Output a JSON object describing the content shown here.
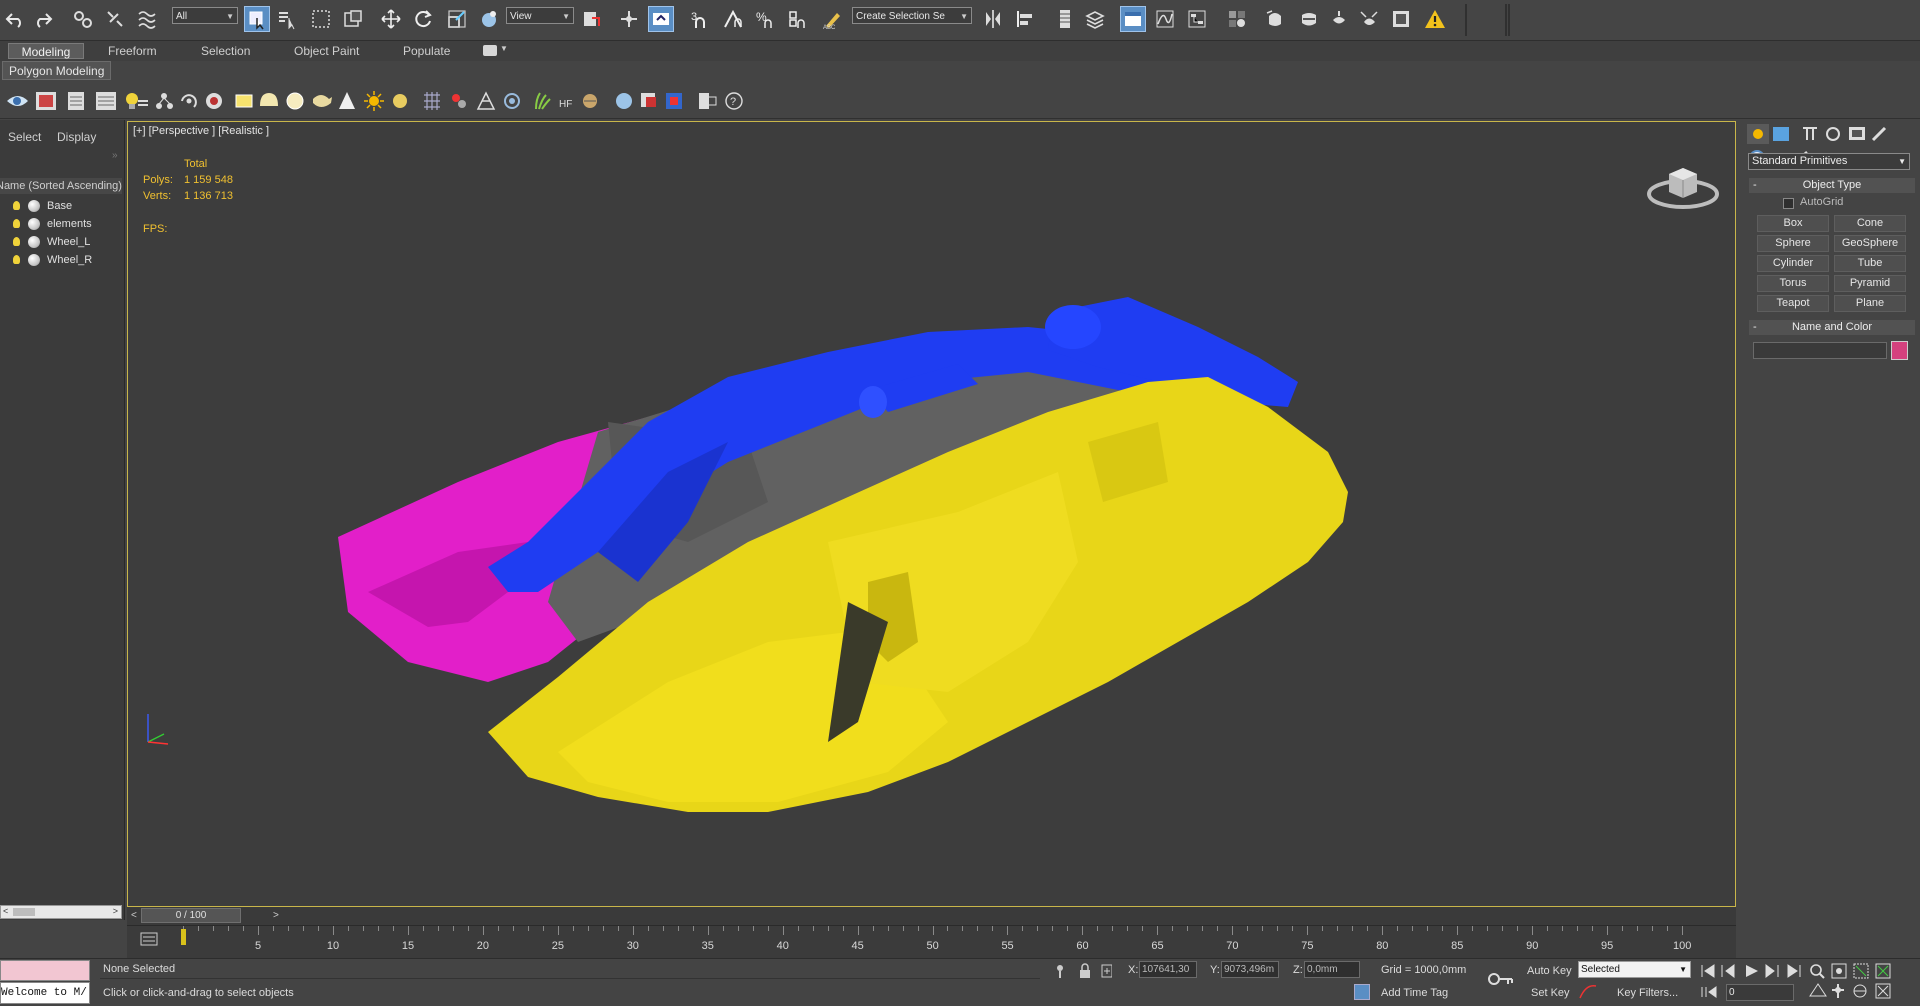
{
  "toolbar": {
    "selection_filter": "All",
    "ref_coord": "View",
    "named_selection_set": "Create Selection Se"
  },
  "ribbon": {
    "tabs": [
      "Modeling",
      "Freeform",
      "Selection",
      "Object Paint",
      "Populate"
    ],
    "active_tab": "Modeling",
    "panel_label": "Polygon Modeling"
  },
  "scene_explorer": {
    "tabs": [
      "Select",
      "Display"
    ],
    "header": "Name (Sorted Ascending)",
    "items": [
      "Base",
      "elements",
      "Wheel_L",
      "Wheel_R"
    ]
  },
  "viewport": {
    "label": "[+] [Perspective ] [Realistic ]",
    "stats": {
      "total_label": "Total",
      "polys_label": "Polys:",
      "polys_value": "1 159 548",
      "verts_label": "Verts:",
      "verts_value": "1 136 713",
      "fps_label": "FPS:"
    },
    "object_colors": {
      "tracks_left": "#e21fc9",
      "frame": "#1f3df2",
      "tracks_right": "#e8d618",
      "hull": "#616161"
    }
  },
  "command_panel": {
    "category": "Standard Primitives",
    "object_type_title": "Object Type",
    "autogrid": "AutoGrid",
    "buttons": [
      "Box",
      "Cone",
      "Sphere",
      "GeoSphere",
      "Cylinder",
      "Tube",
      "Torus",
      "Pyramid",
      "Teapot",
      "Plane"
    ],
    "name_color_title": "Name and Color",
    "swatch_color": "#d4417e"
  },
  "timeline": {
    "slider_label": "0 / 100",
    "ticks": [
      "5",
      "10",
      "15",
      "20",
      "25",
      "30",
      "35",
      "40",
      "45",
      "50",
      "55",
      "60",
      "65",
      "70",
      "75",
      "80",
      "85",
      "90",
      "95",
      "100"
    ]
  },
  "status": {
    "selection": "None Selected",
    "prompt": "Click or click-and-drag to select objects",
    "maxscript": "Welcome to M/",
    "x_label": "X:",
    "x_value": "107641,30",
    "y_label": "Y:",
    "y_value": "9073,496m",
    "z_label": "Z:",
    "z_value": "0,0mm",
    "grid": "Grid = 1000,0mm",
    "add_time_tag": "Add Time Tag",
    "auto_key": "Auto Key",
    "set_key": "Set Key",
    "key_mode": "Selected",
    "key_filters": "Key Filters...",
    "frame": "0"
  }
}
